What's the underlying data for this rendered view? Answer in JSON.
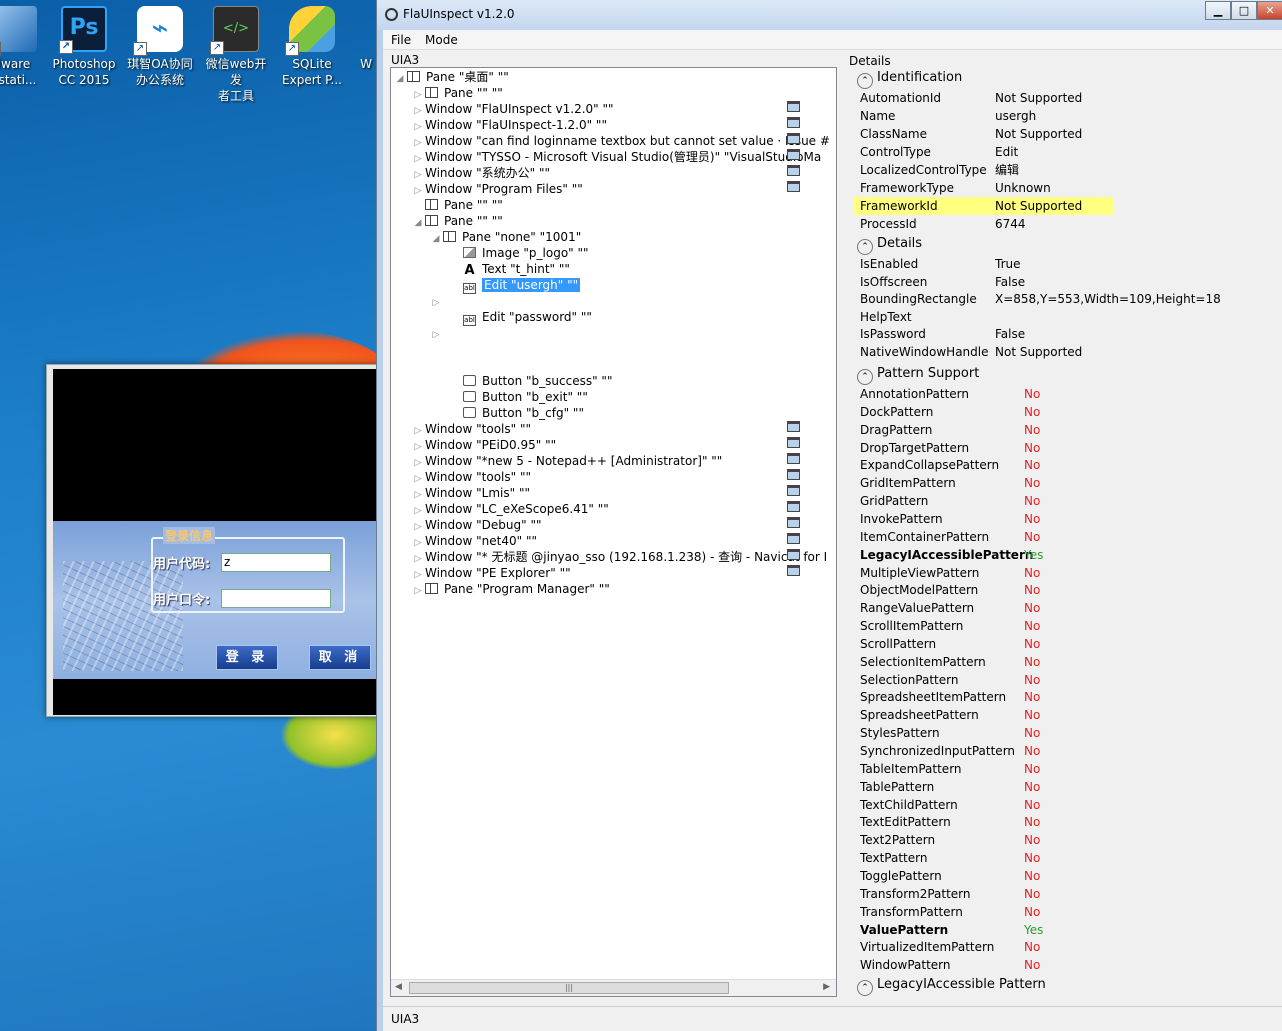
{
  "desktop": {
    "icons": [
      {
        "label1": "lware",
        "label2": "kstati...",
        "icon": "vmware-icon"
      },
      {
        "label1": "Photoshop",
        "label2": "CC 2015",
        "icon": "photoshop-icon"
      },
      {
        "label1": "琪智OA协同",
        "label2": "办公系统",
        "icon": "oa-system-icon"
      },
      {
        "label1": "微信web开发",
        "label2": "者工具",
        "icon": "wechat-devtools-icon"
      },
      {
        "label1": "SQLite",
        "label2": "Expert P...",
        "icon": "sqlite-expert-icon"
      },
      {
        "label1": "W",
        "label2": "",
        "icon": "partial-icon"
      }
    ]
  },
  "login": {
    "group_title": "登录信息",
    "user_label": "用户代码:",
    "user_value": "z",
    "pass_label": "用户口令:",
    "pass_value": "",
    "login_btn": "登 录",
    "cancel_btn": "取 消"
  },
  "window": {
    "title": "FlaUInspect v1.2.0",
    "menu": [
      "File",
      "Mode"
    ],
    "mode_label": "UIA3",
    "status": "UIA3"
  },
  "tree": [
    {
      "text": "Pane \"桌面\" \"\"",
      "icon": "pane",
      "exp": "◢",
      "level": 0
    },
    {
      "text": "Pane \"\" \"\"",
      "icon": "pane",
      "exp": "▷",
      "level": 1
    },
    {
      "text": "Window \"FlaUInspect v1.2.0\" \"\"",
      "icon": "win",
      "exp": "▷",
      "level": 1
    },
    {
      "text": "Window \"FlaUInspect-1.2.0\" \"\"",
      "icon": "win",
      "exp": "▷",
      "level": 1
    },
    {
      "text": "Window \"can find loginname textbox but cannot set value · Issue #",
      "icon": "win",
      "exp": "▷",
      "level": 1
    },
    {
      "text": "Window \"TYSSO - Microsoft Visual Studio(管理员)\" \"VisualStudioMa",
      "icon": "win",
      "exp": "▷",
      "level": 1
    },
    {
      "text": "Window \"系统办公\" \"\"",
      "icon": "win",
      "exp": "▷",
      "level": 1
    },
    {
      "text": "Window \"Program Files\" \"\"",
      "icon": "win",
      "exp": "▷",
      "level": 1
    },
    {
      "text": "Pane \"\" \"\"",
      "icon": "pane",
      "exp": "",
      "level": 1
    },
    {
      "text": "Pane \"\" \"\"",
      "icon": "pane",
      "exp": "◢",
      "level": 1
    },
    {
      "text": "Pane \"none\" \"1001\"",
      "icon": "pane",
      "exp": "◢",
      "level": 2
    },
    {
      "text": "Image \"p_logo\" \"\"",
      "icon": "img",
      "exp": "",
      "level": 3
    },
    {
      "text": "Text \"t_hint\" \"\"",
      "icon": "txt",
      "exp": "",
      "level": 3
    },
    {
      "text": "Edit \"usergh\" \"\"",
      "icon": "edit",
      "exp": "",
      "level": 3,
      "selected": true
    },
    {
      "text": "",
      "icon": "",
      "exp": "▷",
      "level": 2
    },
    {
      "text": "Edit \"password\" \"\"",
      "icon": "edit",
      "exp": "",
      "level": 3
    },
    {
      "text": "",
      "icon": "",
      "exp": "▷",
      "level": 2
    },
    {
      "text": "",
      "icon": "",
      "exp": "",
      "level": 3
    },
    {
      "text": "",
      "icon": "",
      "exp": "",
      "level": 3
    },
    {
      "text": "Button \"b_success\" \"\"",
      "icon": "btn",
      "exp": "",
      "level": 3
    },
    {
      "text": "Button \"b_exit\" \"\"",
      "icon": "btn",
      "exp": "",
      "level": 3
    },
    {
      "text": "Button \"b_cfg\" \"\"",
      "icon": "btn",
      "exp": "",
      "level": 3
    },
    {
      "text": "Window \"tools\" \"\"",
      "icon": "win",
      "exp": "▷",
      "level": 1
    },
    {
      "text": "Window \"PEiD0.95\" \"\"",
      "icon": "win",
      "exp": "▷",
      "level": 1
    },
    {
      "text": "Window \"*new 5 - Notepad++ [Administrator]\" \"\"",
      "icon": "win",
      "exp": "▷",
      "level": 1
    },
    {
      "text": "Window \"tools\" \"\"",
      "icon": "win",
      "exp": "▷",
      "level": 1
    },
    {
      "text": "Window \"Lmis\" \"\"",
      "icon": "win",
      "exp": "▷",
      "level": 1
    },
    {
      "text": "Window \"LC_eXeScope6.41\" \"\"",
      "icon": "win",
      "exp": "▷",
      "level": 1
    },
    {
      "text": "Window \"Debug\" \"\"",
      "icon": "win",
      "exp": "▷",
      "level": 1
    },
    {
      "text": "Window \"net40\" \"\"",
      "icon": "win",
      "exp": "▷",
      "level": 1
    },
    {
      "text": "Window \"* 无标题 @jinyao_sso (192.168.1.238) - 查询 - Navicat for I",
      "icon": "win",
      "exp": "▷",
      "level": 1
    },
    {
      "text": "Window \"PE Explorer\" \"\"",
      "icon": "win",
      "exp": "▷",
      "level": 1
    },
    {
      "text": "Pane \"Program Manager\" \"\"",
      "icon": "pane",
      "exp": "▷",
      "level": 1
    }
  ],
  "details": {
    "header": "Details",
    "identification_title": "Identification",
    "identification": [
      {
        "k": "AutomationId",
        "v": "Not Supported"
      },
      {
        "k": "Name",
        "v": "usergh"
      },
      {
        "k": "ClassName",
        "v": "Not Supported"
      },
      {
        "k": "ControlType",
        "v": "Edit"
      },
      {
        "k": "LocalizedControlType",
        "v": "编辑"
      },
      {
        "k": "FrameworkType",
        "v": "Unknown"
      },
      {
        "k": "FrameworkId",
        "v": "Not Supported",
        "hl": true
      },
      {
        "k": "ProcessId",
        "v": "6744"
      }
    ],
    "details_title": "Details",
    "props": [
      {
        "k": "IsEnabled",
        "v": "True"
      },
      {
        "k": "IsOffscreen",
        "v": "False"
      },
      {
        "k": "BoundingRectangle",
        "v": "X=858,Y=553,Width=109,Height=18"
      },
      {
        "k": "HelpText",
        "v": ""
      },
      {
        "k": "IsPassword",
        "v": "False"
      },
      {
        "k": "NativeWindowHandle",
        "v": "Not Supported"
      }
    ],
    "pattern_title": "Pattern Support",
    "patterns": [
      {
        "k": "AnnotationPattern",
        "v": "No"
      },
      {
        "k": "DockPattern",
        "v": "No"
      },
      {
        "k": "DragPattern",
        "v": "No"
      },
      {
        "k": "DropTargetPattern",
        "v": "No"
      },
      {
        "k": "ExpandCollapsePattern",
        "v": "No"
      },
      {
        "k": "GridItemPattern",
        "v": "No"
      },
      {
        "k": "GridPattern",
        "v": "No"
      },
      {
        "k": "InvokePattern",
        "v": "No"
      },
      {
        "k": "ItemContainerPattern",
        "v": "No"
      },
      {
        "k": "LegacyIAccessiblePattern",
        "v": "Yes"
      },
      {
        "k": "MultipleViewPattern",
        "v": "No"
      },
      {
        "k": "ObjectModelPattern",
        "v": "No"
      },
      {
        "k": "RangeValuePattern",
        "v": "No"
      },
      {
        "k": "ScrollItemPattern",
        "v": "No"
      },
      {
        "k": "ScrollPattern",
        "v": "No"
      },
      {
        "k": "SelectionItemPattern",
        "v": "No"
      },
      {
        "k": "SelectionPattern",
        "v": "No"
      },
      {
        "k": "SpreadsheetItemPattern",
        "v": "No"
      },
      {
        "k": "SpreadsheetPattern",
        "v": "No"
      },
      {
        "k": "StylesPattern",
        "v": "No"
      },
      {
        "k": "SynchronizedInputPattern",
        "v": "No"
      },
      {
        "k": "TableItemPattern",
        "v": "No"
      },
      {
        "k": "TablePattern",
        "v": "No"
      },
      {
        "k": "TextChildPattern",
        "v": "No"
      },
      {
        "k": "TextEditPattern",
        "v": "No"
      },
      {
        "k": "Text2Pattern",
        "v": "No"
      },
      {
        "k": "TextPattern",
        "v": "No"
      },
      {
        "k": "TogglePattern",
        "v": "No"
      },
      {
        "k": "Transform2Pattern",
        "v": "No"
      },
      {
        "k": "TransformPattern",
        "v": "No"
      },
      {
        "k": "ValuePattern",
        "v": "Yes"
      },
      {
        "k": "VirtualizedItemPattern",
        "v": "No"
      },
      {
        "k": "WindowPattern",
        "v": "No"
      }
    ],
    "legacy_title": "LegacyIAccessible Pattern"
  },
  "colors": {
    "no": "#e02020",
    "yes": "#2e9b2e",
    "highlight": "#ffff80",
    "selection": "#3399ff"
  }
}
